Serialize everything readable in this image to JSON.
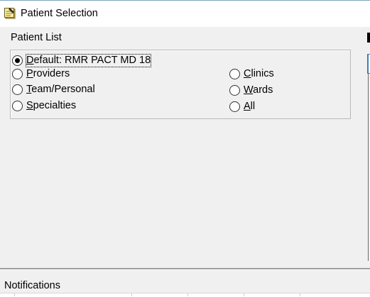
{
  "window": {
    "title": "Patient Selection"
  },
  "patient_list": {
    "label": "Patient List",
    "options": [
      {
        "prefix": "",
        "key": "D",
        "rest": "efault: RMR PACT MD 18",
        "checked": true
      },
      {
        "prefix": "",
        "key": "P",
        "rest": "roviders",
        "checked": false
      },
      {
        "prefix": "",
        "key": "T",
        "rest": "eam/Personal",
        "checked": false
      },
      {
        "prefix": "",
        "key": "S",
        "rest": "pecialties",
        "checked": false
      },
      {
        "prefix": "",
        "key": "C",
        "rest": "linics",
        "checked": false
      },
      {
        "prefix": "",
        "key": "W",
        "rest": "ards",
        "checked": false
      },
      {
        "prefix": "",
        "key": "A",
        "rest": "ll",
        "checked": false
      }
    ]
  },
  "notifications": {
    "label": "Notifications"
  },
  "icons": {
    "title_icon": "notepad-icon"
  }
}
